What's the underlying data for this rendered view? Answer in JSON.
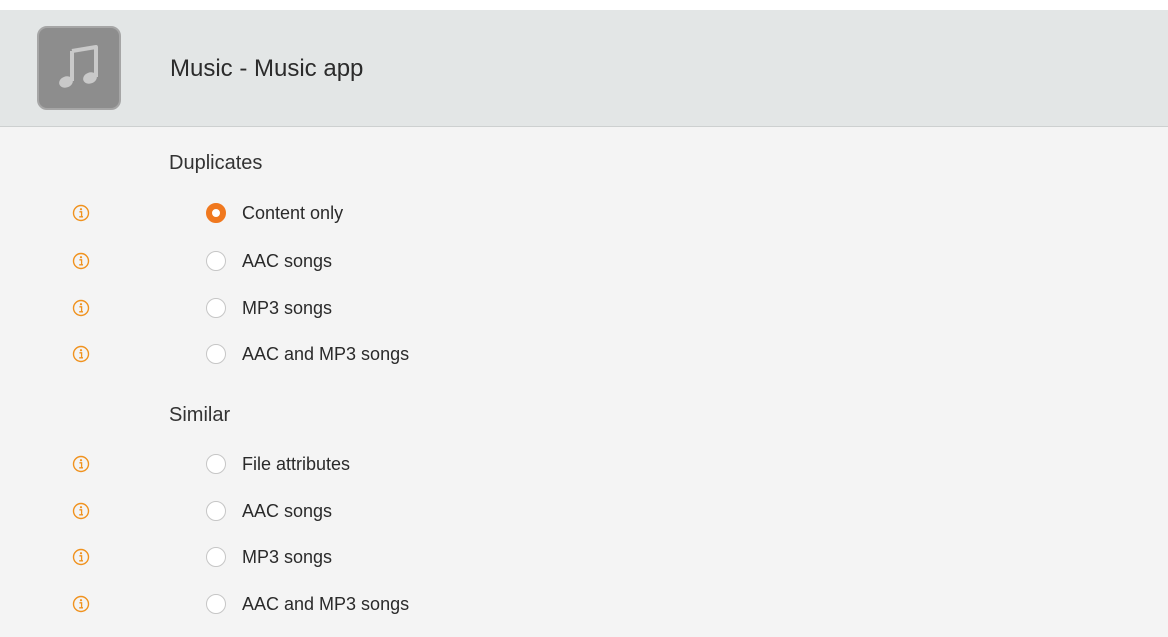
{
  "header": {
    "icon": "music-note-icon",
    "title": "Music - Music app"
  },
  "colors": {
    "accent": "#f0781e",
    "info_icon": "#f0921e",
    "header_bg": "#e3e6e6",
    "panel_bg": "#f4f4f4"
  },
  "sections": [
    {
      "heading": "Duplicates",
      "options": [
        {
          "label": "Content only",
          "selected": true,
          "info_icon": "info-icon"
        },
        {
          "label": "AAC songs",
          "selected": false,
          "info_icon": "info-icon"
        },
        {
          "label": "MP3 songs",
          "selected": false,
          "info_icon": "info-icon"
        },
        {
          "label": "AAC and MP3 songs",
          "selected": false,
          "info_icon": "info-icon"
        }
      ]
    },
    {
      "heading": "Similar",
      "options": [
        {
          "label": "File attributes",
          "selected": false,
          "info_icon": "info-icon"
        },
        {
          "label": "AAC songs",
          "selected": false,
          "info_icon": "info-icon"
        },
        {
          "label": "MP3 songs",
          "selected": false,
          "info_icon": "info-icon"
        },
        {
          "label": "AAC and MP3 songs",
          "selected": false,
          "info_icon": "info-icon"
        }
      ]
    }
  ]
}
